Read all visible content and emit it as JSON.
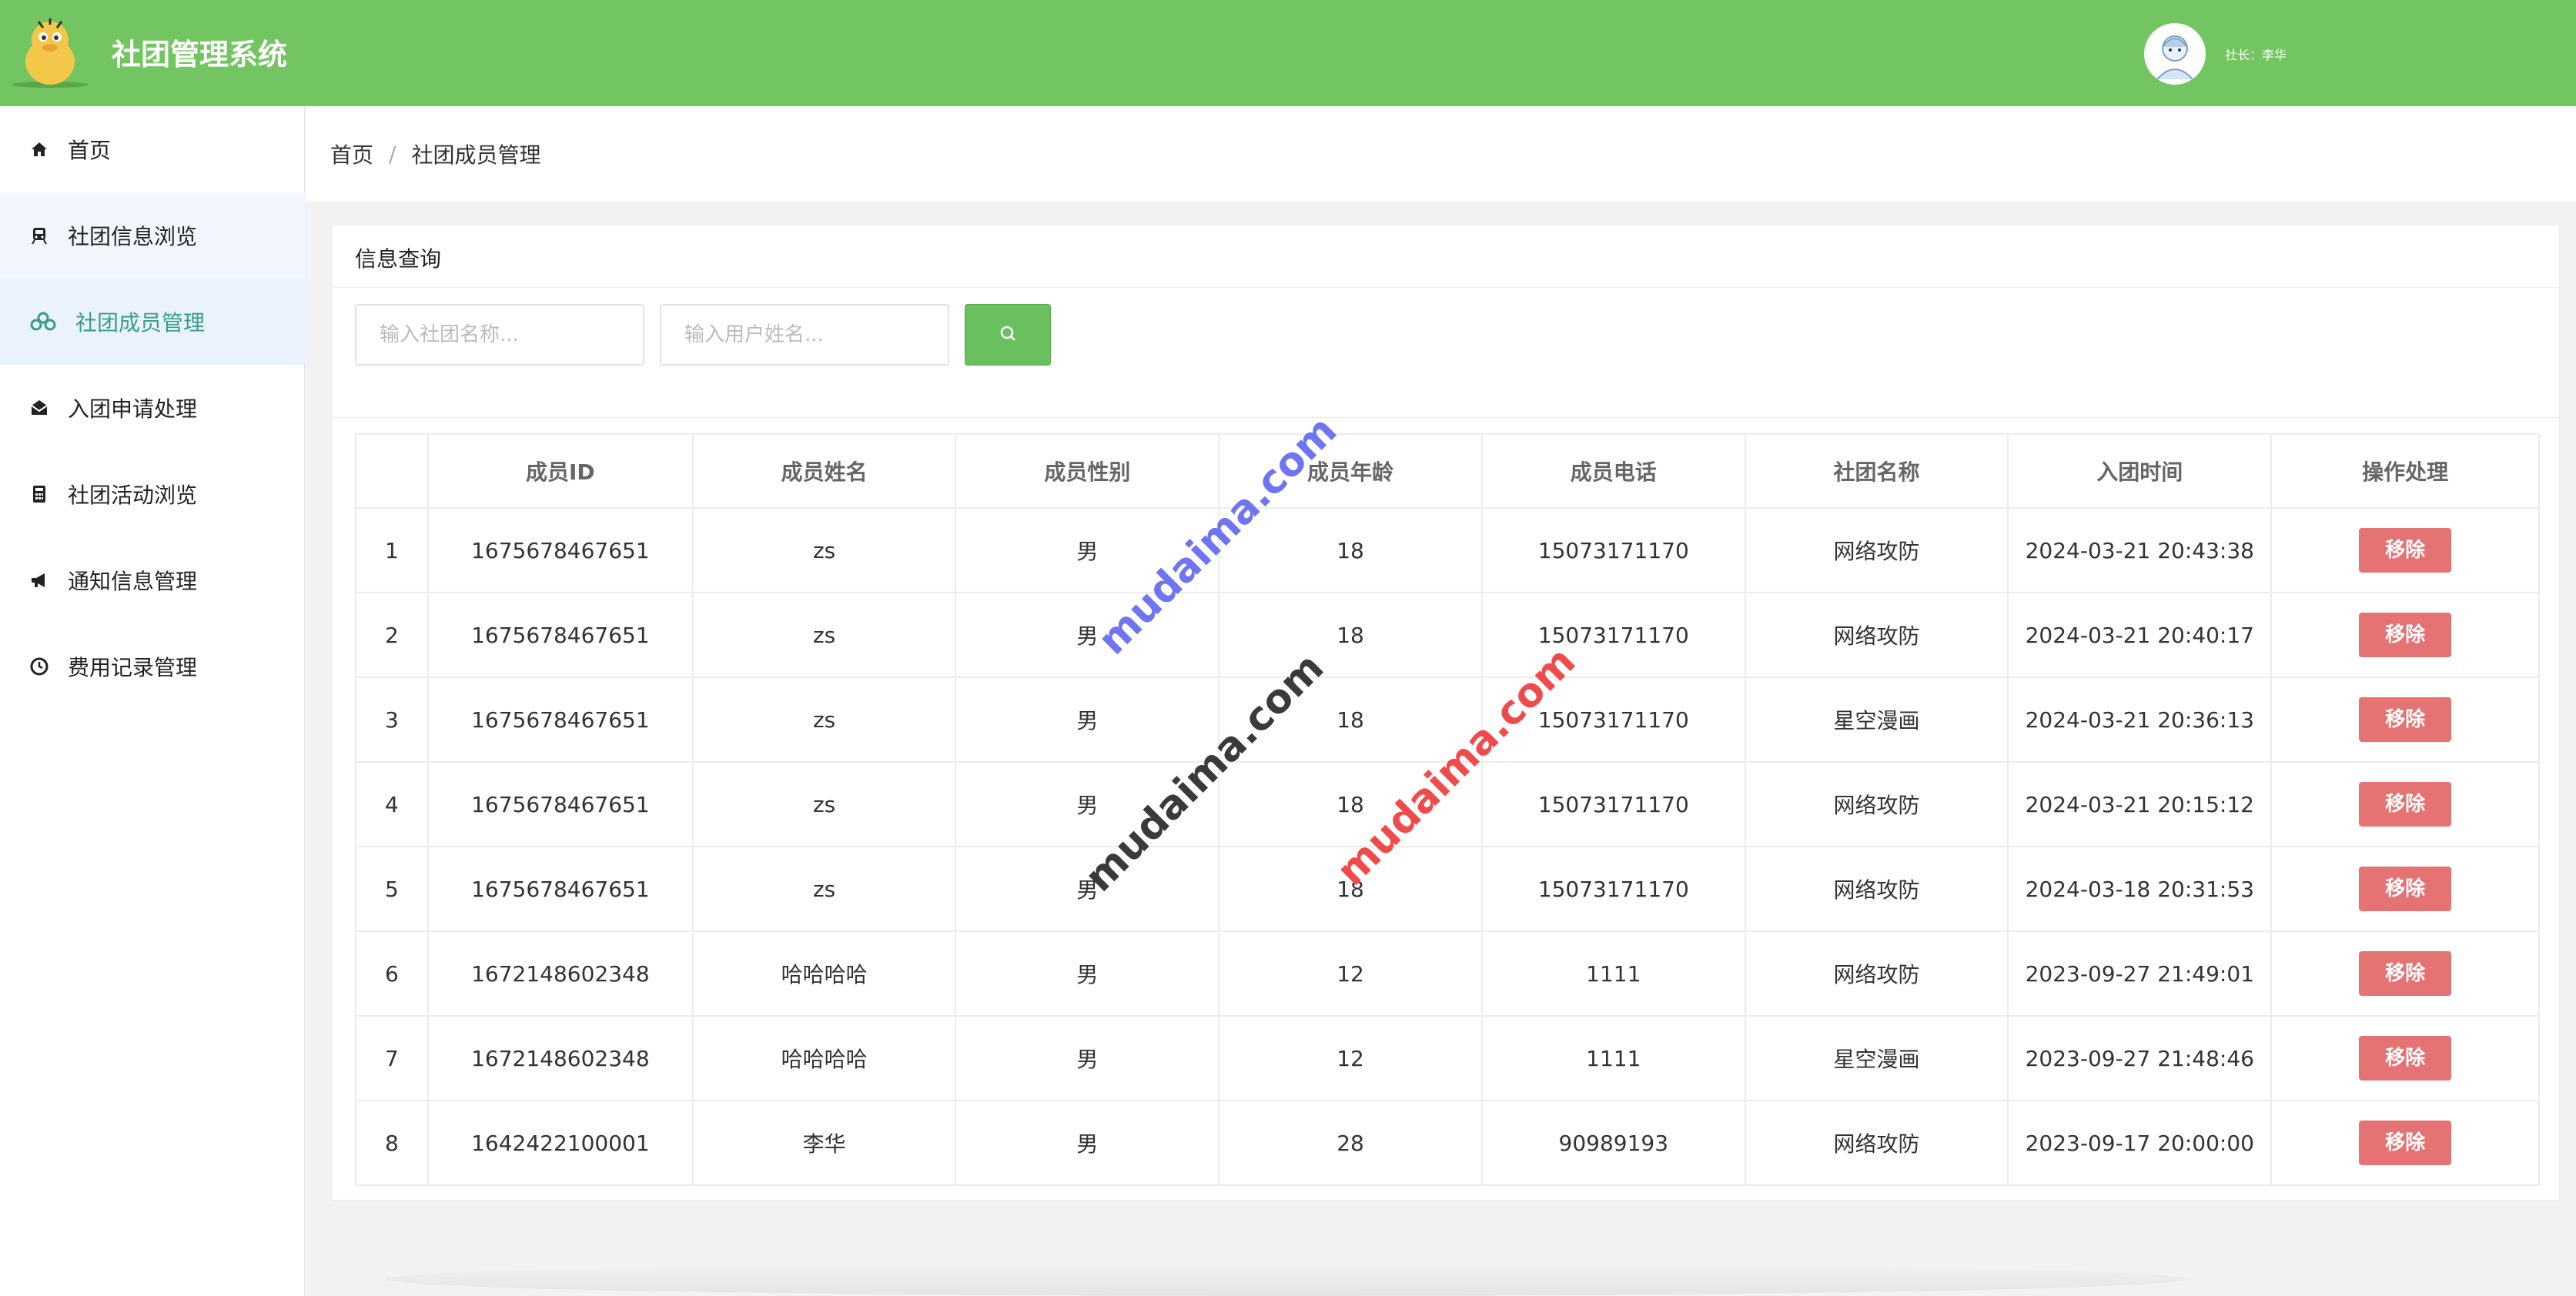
{
  "header": {
    "title": "社团管理系统",
    "user_label": "社长：李华"
  },
  "sidebar": {
    "items": [
      {
        "label": "首页",
        "icon": "home-icon"
      },
      {
        "label": "社团信息浏览",
        "icon": "train-icon"
      },
      {
        "label": "社团成员管理",
        "icon": "users-icon"
      },
      {
        "label": "入团申请处理",
        "icon": "envelope-icon"
      },
      {
        "label": "社团活动浏览",
        "icon": "calculator-icon"
      },
      {
        "label": "通知信息管理",
        "icon": "megaphone-icon"
      },
      {
        "label": "费用记录管理",
        "icon": "clock-icon"
      }
    ],
    "active_index": 2
  },
  "breadcrumb": {
    "home": "首页",
    "separator": "/",
    "current": "社团成员管理"
  },
  "query": {
    "title": "信息查询",
    "club_placeholder": "输入社团名称...",
    "user_placeholder": "输入用户姓名..."
  },
  "table": {
    "headers": [
      "",
      "成员ID",
      "成员姓名",
      "成员性别",
      "成员年龄",
      "成员电话",
      "社团名称",
      "入团时间",
      "操作处理"
    ],
    "action_label": "移除",
    "rows": [
      [
        "1",
        "1675678467651",
        "zs",
        "男",
        "18",
        "15073171170",
        "网络攻防",
        "2024-03-21 20:43:38"
      ],
      [
        "2",
        "1675678467651",
        "zs",
        "男",
        "18",
        "15073171170",
        "网络攻防",
        "2024-03-21 20:40:17"
      ],
      [
        "3",
        "1675678467651",
        "zs",
        "男",
        "18",
        "15073171170",
        "星空漫画",
        "2024-03-21 20:36:13"
      ],
      [
        "4",
        "1675678467651",
        "zs",
        "男",
        "18",
        "15073171170",
        "网络攻防",
        "2024-03-21 20:15:12"
      ],
      [
        "5",
        "1675678467651",
        "zs",
        "男",
        "18",
        "15073171170",
        "网络攻防",
        "2024-03-18 20:31:53"
      ],
      [
        "6",
        "1672148602348",
        "哈哈哈哈",
        "男",
        "12",
        "1111",
        "网络攻防",
        "2023-09-27 21:49:01"
      ],
      [
        "7",
        "1672148602348",
        "哈哈哈哈",
        "男",
        "12",
        "1111",
        "星空漫画",
        "2023-09-27 21:48:46"
      ],
      [
        "8",
        "1642422100001",
        "李华",
        "男",
        "28",
        "90989193",
        "网络攻防",
        "2023-09-17 20:00:00"
      ]
    ]
  },
  "watermarks": [
    "mudaima.com",
    "mudaima.com",
    "mudaima.com"
  ],
  "colors": {
    "header_bg": "#72c560",
    "search_btn": "#6abf5e",
    "remove_btn": "#e57373",
    "active_nav_text": "#3b9b8d"
  }
}
